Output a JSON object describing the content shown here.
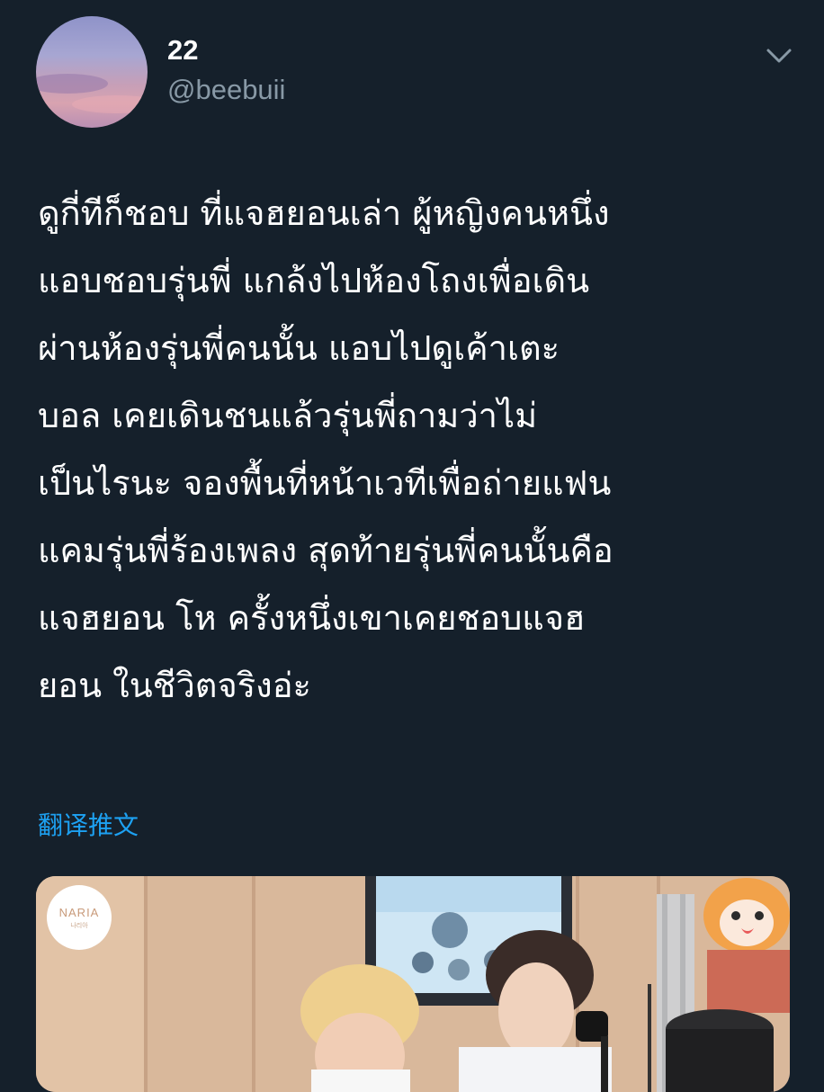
{
  "author": {
    "display_name": "22",
    "handle": "@beebuii"
  },
  "tweet": {
    "lines": [
      "ดูกี่ทีก็ชอบ ที่แจฮยอนเล่า ผู้หญิงคนหนึ่ง",
      "แอบชอบรุ่นพี่ แกล้งไปห้องโถงเพื่อเดิน",
      "ผ่านห้องรุ่นพี่คนนั้น แอบไปดูเค้าเตะ",
      "บอล เคยเดินชนแล้วรุ่นพี่ถามว่าไม่",
      "เป็นไรนะ จองพื้นที่หน้าเวทีเพื่อถ่ายแฟน",
      "แคมรุ่นพี่ร้องเพลง สุดท้ายรุ่นพี่คนนั้นคือ",
      "แจฮยอน โห ครั้งหนึ่งเขาเคยชอบแจฮ",
      "ยอน ในชีวิตจริงอ่ะ"
    ],
    "translate_label": "翻译推文"
  },
  "media": {
    "logo_text": "NARIA",
    "logo_subtext": "나리아"
  },
  "colors": {
    "background": "#15202b",
    "text": "#ffffff",
    "secondary": "#8899a6",
    "link": "#1da1f2"
  }
}
